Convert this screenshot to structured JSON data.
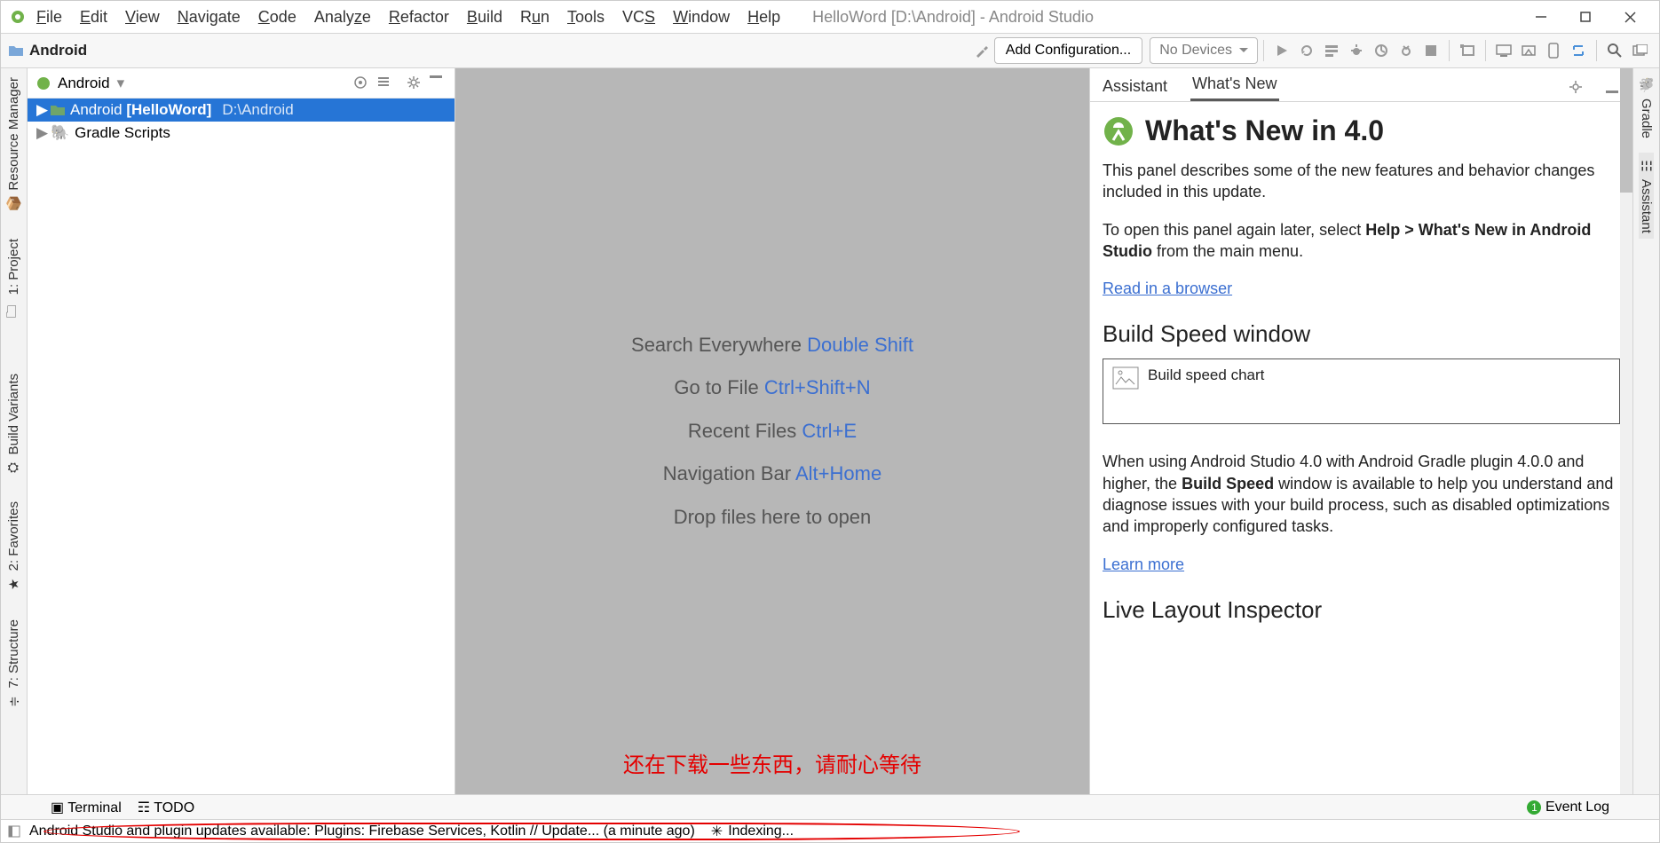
{
  "window": {
    "title": "HelloWord [D:\\Android] - Android Studio"
  },
  "menu": [
    "File",
    "Edit",
    "View",
    "Navigate",
    "Code",
    "Analyze",
    "Refactor",
    "Build",
    "Run",
    "Tools",
    "VCS",
    "Window",
    "Help"
  ],
  "navbar": {
    "project": "Android",
    "add_config": "Add Configuration...",
    "no_devices": "No Devices"
  },
  "left_tabs": {
    "resource_manager": "Resource Manager",
    "project": "1: Project",
    "build_variants": "Build Variants",
    "favorites": "2: Favorites",
    "structure": "7: Structure"
  },
  "right_tabs": {
    "gradle": "Gradle",
    "assistant": "Assistant"
  },
  "project_panel": {
    "dropdown": "Android",
    "rows": [
      {
        "label_pre": "Android ",
        "label_bold": "[HelloWord]",
        "path": "D:\\Android"
      },
      {
        "label": "Gradle Scripts"
      }
    ]
  },
  "editor_hints": [
    {
      "label": "Search Everywhere ",
      "shortcut": "Double Shift"
    },
    {
      "label": "Go to File ",
      "shortcut": "Ctrl+Shift+N"
    },
    {
      "label": "Recent Files ",
      "shortcut": "Ctrl+E"
    },
    {
      "label": "Navigation Bar ",
      "shortcut": "Alt+Home"
    },
    {
      "label": "Drop files here to open",
      "shortcut": ""
    }
  ],
  "annotation": "还在下载一些东西，请耐心等待",
  "assistant_panel": {
    "tabs": {
      "assistant": "Assistant",
      "whats_new": "What's New"
    },
    "title": "What's New in 4.0",
    "p1": "This panel describes some of the new features and behavior changes included in this update.",
    "p2_pre": "To open this panel again later, select ",
    "p2_bold1": "Help > What's New in Android Studio",
    "p2_post": " from the main menu.",
    "link1": "Read in a browser",
    "h2_1": "Build Speed window",
    "img_caption": "Build speed chart",
    "p3_pre": "When using Android Studio 4.0 with Android Gradle plugin 4.0.0 and higher, the ",
    "p3_bold": "Build Speed",
    "p3_post": " window is available to help you understand and diagnose issues with your build process, such as disabled optimizations and improperly configured tasks.",
    "link2": "Learn more",
    "h2_2": "Live Layout Inspector"
  },
  "bottom_tabs": {
    "terminal": "Terminal",
    "todo": "TODO",
    "event_log": "Event Log"
  },
  "status_bar": {
    "msg": "Android Studio and plugin updates available: Plugins: Firebase Services, Kotlin // Update... (a minute ago)",
    "indexing": "Indexing..."
  }
}
